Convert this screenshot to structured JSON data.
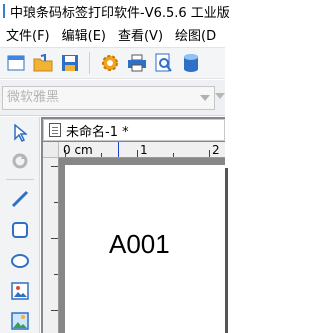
{
  "window": {
    "title": "中琅条码标签打印软件-V6.5.6 工业版"
  },
  "menu": [
    "文件(F)",
    "编辑(E)",
    "查看(V)",
    "绘图(D"
  ],
  "toolbar": {
    "icons": [
      "new-document-icon",
      "open-folder-icon",
      "save-icon",
      "settings-gear-icon",
      "print-icon",
      "print-preview-icon",
      "database-icon"
    ]
  },
  "font_bar": {
    "font_name": "微软雅黑"
  },
  "tools": {
    "icons": [
      "select-pointer-icon",
      "rotate-icon",
      "line-icon",
      "rounded-rectangle-icon",
      "ellipse-icon",
      "image-icon",
      "picture-icon"
    ]
  },
  "document": {
    "tab_label": "未命名-1 *",
    "ruler_unit": "0 cm",
    "ruler_marks": [
      "1",
      "2"
    ],
    "label_text": "A001"
  },
  "colors": {
    "accent": "#3b7bd4",
    "canvas_bg": "#878787",
    "ruler_marker": "#1f3fd0"
  }
}
